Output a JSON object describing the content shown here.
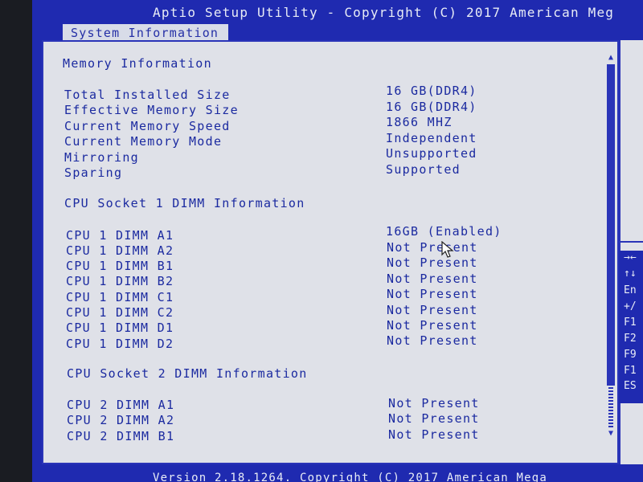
{
  "header": {
    "title": "Aptio Setup Utility - Copyright (C) 2017 American Meg"
  },
  "tab": {
    "label": "System Information"
  },
  "memory": {
    "heading": "Memory Information",
    "rows": [
      {
        "label": "Total Installed Size",
        "value": "16 GB(DDR4)"
      },
      {
        "label": "Effective Memory Size",
        "value": "16 GB(DDR4)"
      },
      {
        "label": "Current Memory Speed",
        "value": "1866 MHZ"
      },
      {
        "label": "Current Memory Mode",
        "value": "Independent"
      },
      {
        "label": "Mirroring",
        "value": "Unsupported"
      },
      {
        "label": "Sparing",
        "value": "Supported"
      }
    ]
  },
  "socket1": {
    "heading": "CPU Socket 1 DIMM Information",
    "rows": [
      {
        "label": "CPU 1 DIMM A1",
        "value": "16GB (Enabled)"
      },
      {
        "label": "CPU 1 DIMM A2",
        "value": "Not Present"
      },
      {
        "label": "CPU 1 DIMM B1",
        "value": "Not Present"
      },
      {
        "label": "CPU 1 DIMM B2",
        "value": "Not Present"
      },
      {
        "label": "CPU 1 DIMM C1",
        "value": "Not Present"
      },
      {
        "label": "CPU 1 DIMM C2",
        "value": "Not Present"
      },
      {
        "label": "CPU 1 DIMM D1",
        "value": "Not Present"
      },
      {
        "label": "CPU 1 DIMM D2",
        "value": "Not Present"
      }
    ]
  },
  "socket2": {
    "heading": "CPU Socket 2 DIMM Information",
    "rows": [
      {
        "label": "CPU 2 DIMM A1",
        "value": "Not Present"
      },
      {
        "label": "CPU 2 DIMM A2",
        "value": "Not Present"
      },
      {
        "label": "CPU 2 DIMM B1",
        "value": "Not Present"
      }
    ]
  },
  "help_keys": [
    "→←",
    "↑↓",
    "En",
    "+/",
    "F1",
    "F2",
    "F9",
    "F1",
    "ES"
  ],
  "footer": {
    "text": "Version 2.18.1264. Copyright (C) 2017 American Mega"
  },
  "colors": {
    "bios_blue": "#1f2ab0",
    "panel_gray": "#dfe1e8",
    "text_blue": "#1b2aa0"
  }
}
